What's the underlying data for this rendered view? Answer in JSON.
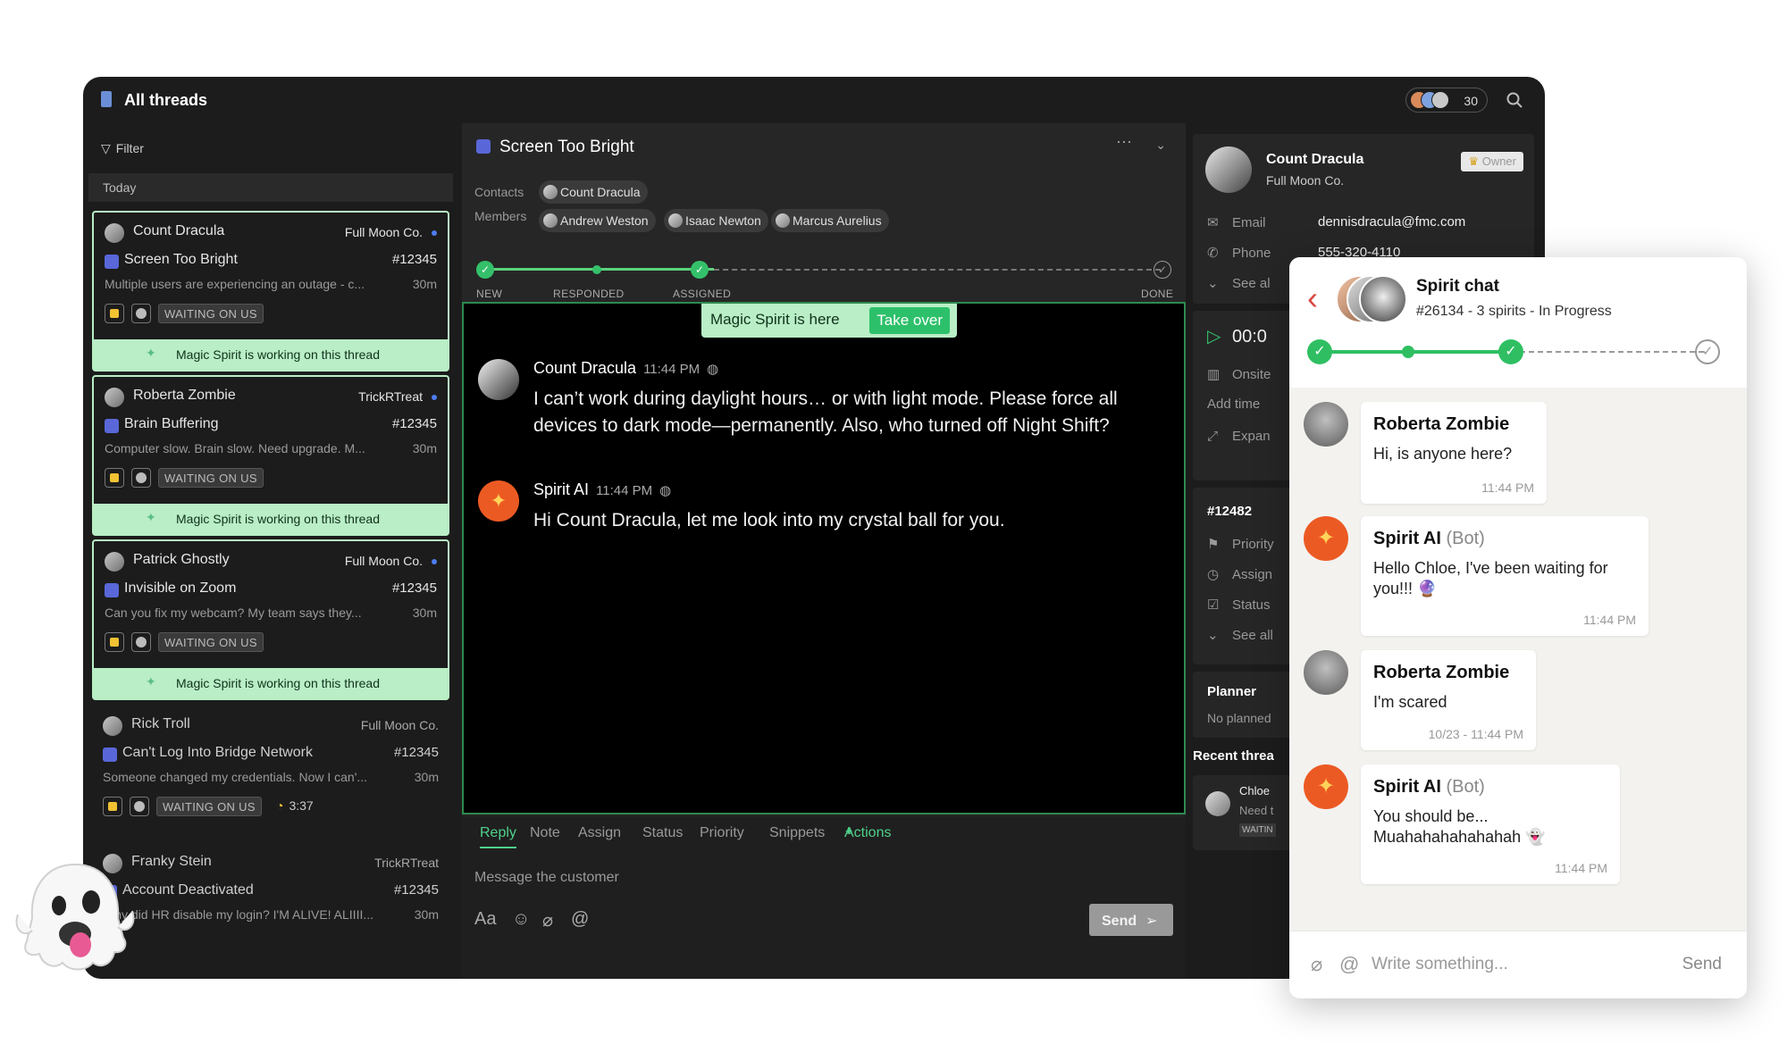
{
  "app": {
    "title": "All threads",
    "participants_count": "30"
  },
  "left": {
    "filter_label": "Filter",
    "section_label": "Today",
    "threads": [
      {
        "name": "Count Dracula",
        "company": "Full Moon Co.",
        "subject": "Screen Too Bright",
        "ticket": "#12345",
        "snippet": "Multiple users are experiencing an outage - c...",
        "age": "30m",
        "status": "WAITING ON US",
        "magic": "Magic Spirit is working on this thread"
      },
      {
        "name": "Roberta Zombie",
        "company": "TrickRTreat",
        "subject": "Brain Buffering",
        "ticket": "#12345",
        "snippet": "Computer slow. Brain slow. Need upgrade. M...",
        "age": "30m",
        "status": "WAITING ON US",
        "magic": "Magic Spirit is working on this thread"
      },
      {
        "name": "Patrick Ghostly",
        "company": "Full Moon Co.",
        "subject": "Invisible on Zoom",
        "ticket": "#12345",
        "snippet": "Can you fix my webcam? My team says they...",
        "age": "30m",
        "status": "WAITING ON US",
        "magic": "Magic Spirit is working on this thread"
      },
      {
        "name": "Rick Troll",
        "company": "Full Moon Co.",
        "subject": "Can't Log Into Bridge Network",
        "ticket": "#12345",
        "snippet": "Someone changed my credentials. Now I can'...",
        "age": "30m",
        "status": "WAITING ON US",
        "timer": "3:37"
      },
      {
        "name": "Franky Stein",
        "company": "TrickRTreat",
        "subject": "Account Deactivated",
        "ticket": "#12345",
        "snippet": "Why did HR disable my login? I'M ALIVE! ALIIII...",
        "age": "30m"
      }
    ]
  },
  "mid": {
    "title": "Screen Too Bright",
    "contacts_label": "Contacts",
    "members_label": "Members",
    "contacts": [
      "Count Dracula"
    ],
    "members": [
      "Andrew Weston",
      "Isaac Newton",
      "Marcus Aurelius"
    ],
    "progress_labels": [
      "NEW",
      "RESPONDED",
      "ASSIGNED",
      "DONE"
    ],
    "magic_banner": "Magic Spirit is here",
    "take_over": "Take over",
    "messages": [
      {
        "author": "Count Dracula",
        "time": "11:44 PM",
        "text": "I can’t work during daylight hours… or with light mode. Please force all devices to dark mode—permanently. Also, who turned off Night Shift?"
      },
      {
        "author": "Spirit AI",
        "time": "11:44 PM",
        "text": "Hi Count Dracula, let me look into my crystal ball for you."
      }
    ],
    "composer": {
      "tabs": [
        "Reply",
        "Note",
        "Assign",
        "Status",
        "Priority",
        "Snippets",
        "Actions"
      ],
      "placeholder": "Message the customer",
      "font_label": "Aa",
      "send_label": "Send"
    }
  },
  "right": {
    "contact_name": "Count Dracula",
    "company": "Full Moon Co.",
    "owner_badge": "Owner",
    "email_label": "Email",
    "email": "dennisdracula@fmc.com",
    "phone_label": "Phone",
    "phone": "555-320-4110",
    "see_all": "See al",
    "timer": "00:0",
    "onsite": "Onsite",
    "add_time": "Add time",
    "expand": "Expan",
    "ticket": "#12482",
    "priority": "Priority",
    "assign": "Assign",
    "status": "Status",
    "see_all2": "See all",
    "planner": "Planner",
    "no_planned": "No planned",
    "recent": "Recent threa",
    "recent_name": "Chloe",
    "recent_snip": "Need t",
    "recent_status": "WAITIN"
  },
  "spirit": {
    "title": "Spirit chat",
    "subtitle": "#26134 - 3 spirits - In Progress",
    "messages": [
      {
        "author": "Roberta Zombie",
        "bot": "",
        "text": "Hi, is anyone here?",
        "time": "11:44 PM"
      },
      {
        "author": "Spirit AI",
        "bot": "(Bot)",
        "text": "Hello Chloe, I've been waiting for you!!! 🔮",
        "time": "11:44 PM"
      },
      {
        "author": "Roberta Zombie",
        "bot": "",
        "text": "I'm scared",
        "time": "10/23 - 11:44 PM"
      },
      {
        "author": "Spirit AI",
        "bot": "(Bot)",
        "text": "You should be... Muahahahahahahah 👻",
        "time": "11:44 PM"
      }
    ],
    "placeholder": "Write something...",
    "send_label": "Send"
  }
}
